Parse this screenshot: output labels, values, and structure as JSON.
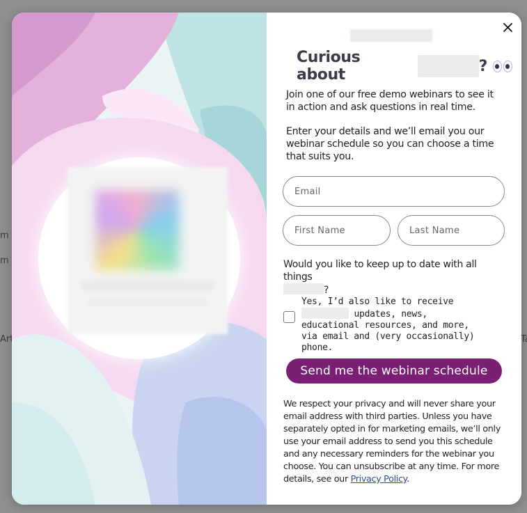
{
  "background": {
    "left_fragments": [
      "m",
      "m",
      "Art"
    ],
    "right_fragments": [
      "Ta"
    ]
  },
  "popup": {
    "close_label": "×",
    "headline": {
      "prefix": "Curious about",
      "suffix": "?"
    },
    "intro": "Join one of our free demo webinars to see it in action and ask questions in real time.",
    "details": "Enter your details and we’ll email you our webinar schedule so you can choose a time that suits you.",
    "form": {
      "email_placeholder": "Email",
      "first_name_placeholder": "First Name",
      "last_name_placeholder": "Last Name",
      "question_prefix": "Would you like to keep up to date with all things",
      "question_suffix": "?",
      "consent_prefix": "Yes, I’d also like to receive",
      "consent_rest": "updates, news, educational resources, and more, via email and (very occasionally) phone.",
      "consent_checked": false,
      "submit_label": "Send me the webinar schedule"
    },
    "privacy": {
      "text": "We respect your privacy and will never share your email address with third parties. Unless you have separately opted in for marketing emails, we’ll only use your email address to send you this schedule and any necessary reminders for the webinar you choose. You can unsubscribe at any time. For more details, see our",
      "link_label": "Privacy Policy",
      "end": "."
    }
  },
  "colors": {
    "button": "#7a1f73",
    "link": "#2a4f9a",
    "headline": "#3b3b4a"
  },
  "icons": [
    "close-icon",
    "eyes-emoji-icon"
  ]
}
